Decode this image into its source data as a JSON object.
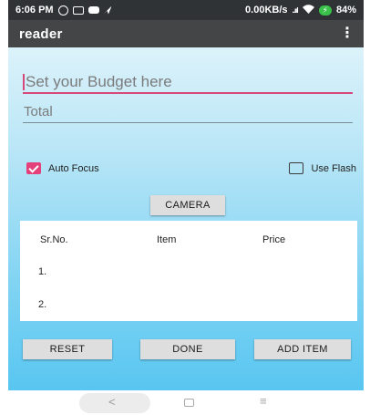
{
  "status_bar": {
    "time": "6:06 PM",
    "network_speed": "0.00KB/s",
    "signal": "..ııl",
    "battery": "84%",
    "battery_badge": "⚡"
  },
  "app_bar": {
    "title": "reader",
    "overflow": "⋮"
  },
  "form": {
    "budget_placeholder": "Set your Budget here",
    "total_placeholder": "Total"
  },
  "options": {
    "auto_focus_label": "Auto Focus",
    "auto_focus_checked": true,
    "use_flash_label": "Use Flash",
    "use_flash_checked": false
  },
  "buttons": {
    "camera": "CAMERA",
    "reset": "RESET",
    "done": "DONE",
    "add_item": "ADD ITEM"
  },
  "table": {
    "headers": [
      "Sr.No.",
      "Item",
      "Price"
    ],
    "rows": [
      "1.",
      "2."
    ]
  },
  "nav": {
    "back": "<",
    "menu": "≡"
  },
  "colors": {
    "accent": "#d7487a",
    "checkbox": "#e4407a",
    "app_bar": "#434547",
    "status_bar": "#2f3335",
    "gradient_top": "#dcf2fa",
    "gradient_bottom": "#58c6f1"
  }
}
